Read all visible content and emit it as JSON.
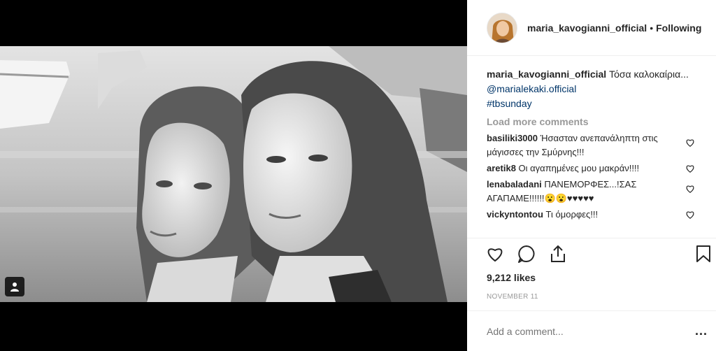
{
  "post": {
    "username": "maria_kavogianni_official",
    "follow_sep": "•",
    "follow_label": "Following",
    "caption": {
      "user": "maria_kavogianni_official",
      "text": "Τόσα καλοκαίρια... ",
      "mention": "@marialekaki.official",
      "hashtag": "#tbsunday"
    },
    "load_more": "Load more comments",
    "comments": [
      {
        "user": "basiliki3000",
        "text": "Ήσασταν ανεπανάληπτη στις μάγισσες την Σμύρνης!!!"
      },
      {
        "user": "aretik8",
        "text": "Οι αγαπημένες μου μακράν!!!!"
      },
      {
        "user": "lenabaladani",
        "text": "ΠΑΝΕΜΟΡΦΕΣ...!ΣΑΣ ΑΓΑΠΑΜΕ!!!!!!😮😮♥♥♥♥♥"
      },
      {
        "user": "vickyntontou",
        "text": "Τι όμορφες!!!"
      }
    ],
    "likes": "9,212 likes",
    "date": "NOVEMBER 11",
    "add_comment_placeholder": "Add a comment...",
    "more_label": "..."
  },
  "icons": {
    "like": "heart-icon",
    "comment": "comment-icon",
    "share": "share-icon",
    "save": "bookmark-icon",
    "tag": "user-tag-icon"
  },
  "colors": {
    "link": "#003569",
    "muted": "#999999",
    "text": "#262626"
  }
}
